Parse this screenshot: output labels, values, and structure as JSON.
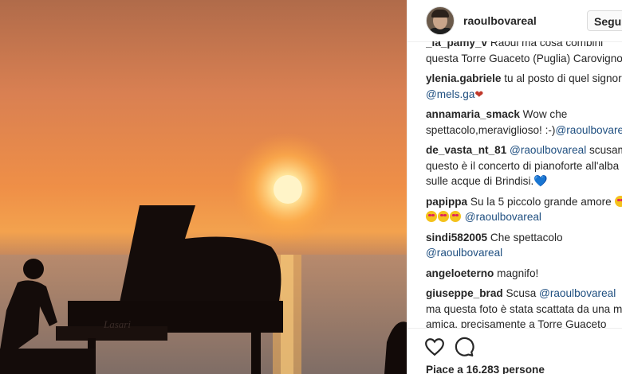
{
  "post": {
    "username": "raoulbovareal",
    "follow_label": "Segui",
    "piano_brand": "Lasari"
  },
  "comments": [
    {
      "user": "_la_pamy_v",
      "text": "Raoul ma cosa combini questa Torre Guaceto (Puglia) Carovigno!!!"
    },
    {
      "user": "ylenia.gabriele",
      "text": "tu al posto di quel signore",
      "mention": "@mels.ga",
      "emoji": "❤"
    },
    {
      "user": "annamaria_smack",
      "text": "Wow che spettacolo,meraviglioso! :-)",
      "mention": "@raoulbovareal"
    },
    {
      "user": "de_vasta_nt_81",
      "mention": "@raoulbovareal",
      "text": "scusami questo è il concerto di pianoforte all'alba sulle acque di Brindisi.",
      "emoji": "💙"
    },
    {
      "user": "papippa",
      "text": "Su la 5 piccolo grande amore",
      "mention": "@raoulbovareal",
      "emoji": "😍"
    },
    {
      "user": "sindi582005",
      "text": "Che spettacolo",
      "mention": "@raoulbovareal"
    },
    {
      "user": "angeloeterno",
      "text": "magnifo!"
    },
    {
      "user": "giuseppe_brad",
      "text_before": "Scusa",
      "mention": "@raoulbovareal",
      "text": "ma questa foto è stata scattata da una mia amica, precisamente a Torre Guaceto (Brindisi)",
      "emoji": "😅"
    }
  ],
  "likes": "Piace a 16.283 persone",
  "icons": {
    "like": "heart-icon",
    "comment": "comment-icon"
  }
}
